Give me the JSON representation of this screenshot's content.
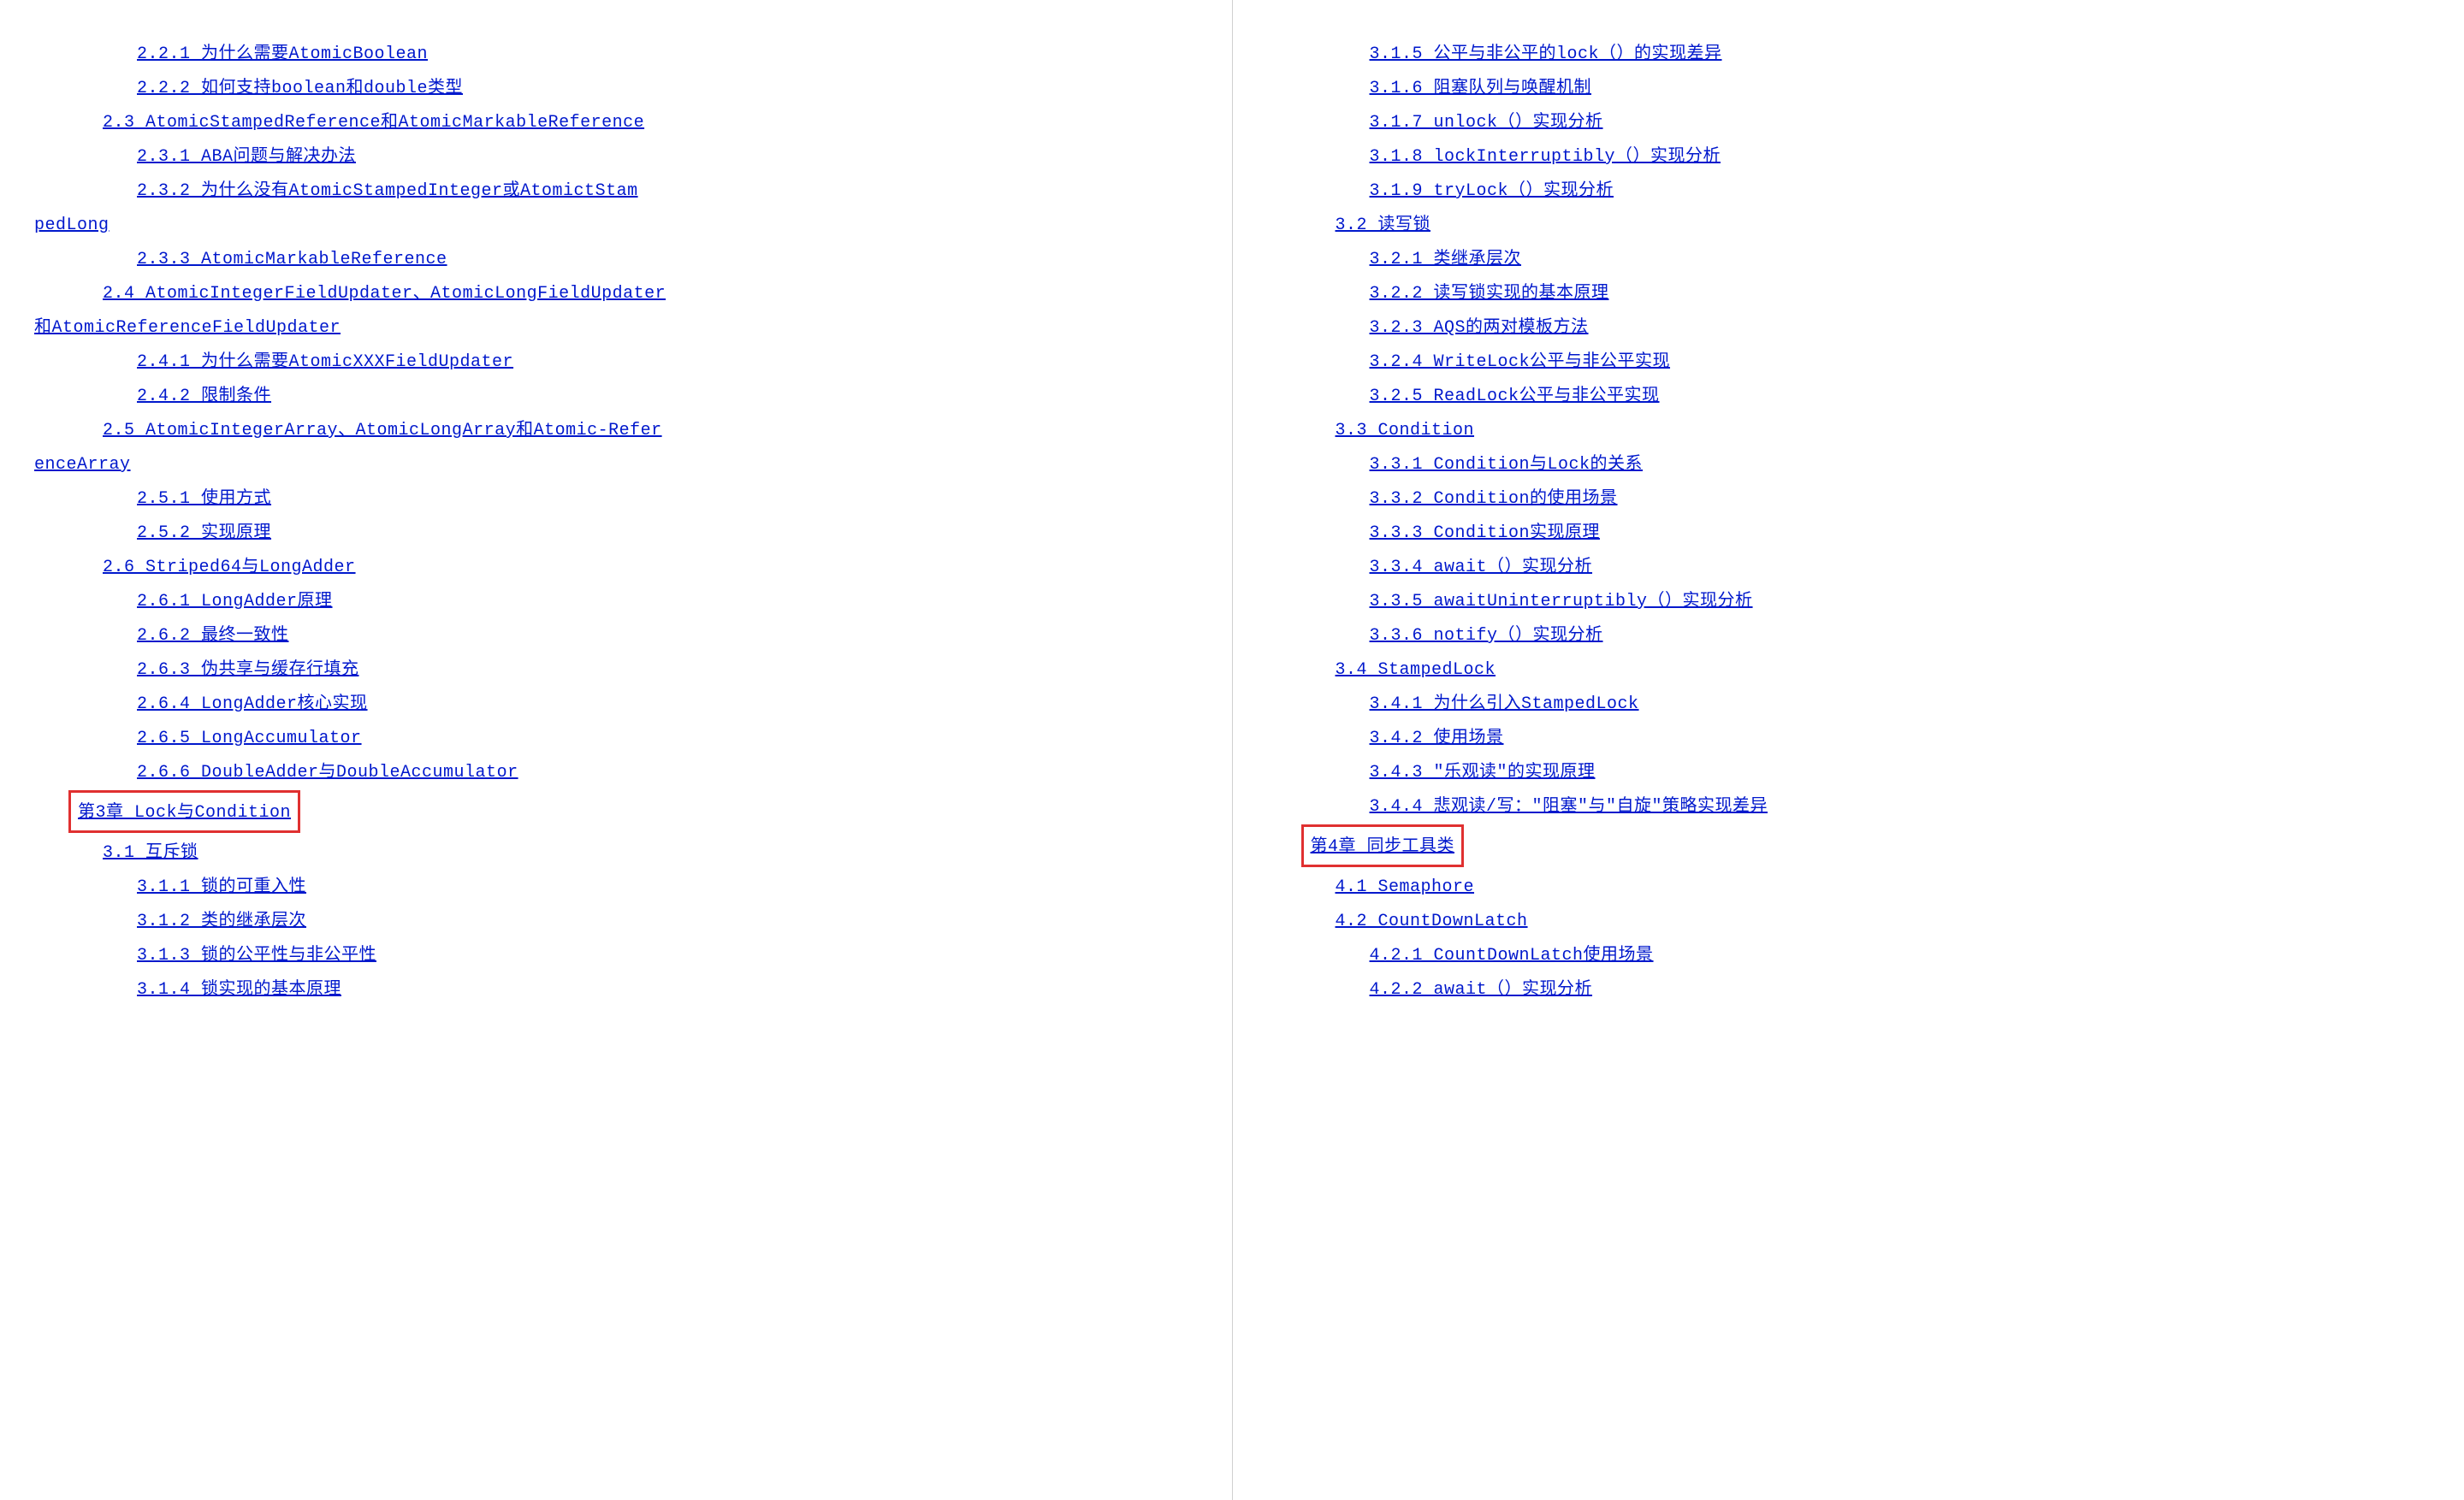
{
  "left": {
    "items": [
      {
        "text": "2.2.1 为什么需要AtomicBoolean",
        "indent": 3
      },
      {
        "text": "2.2.2 如何支持boolean和double类型",
        "indent": 3
      },
      {
        "text": "2.3 AtomicStampedReference和AtomicMarkableReference",
        "indent": 2
      },
      {
        "text": "2.3.1 ABA问题与解决办法",
        "indent": 3
      },
      {
        "text": "2.3.2 为什么没有AtomicStampedInteger或AtomictStam",
        "indent": 3
      },
      {
        "text": "pedLong",
        "indent": 0,
        "continuation": true
      },
      {
        "text": "2.3.3 AtomicMarkableReference",
        "indent": 3
      },
      {
        "text": "2.4 AtomicIntegerFieldUpdater、AtomicLongFieldUpdater",
        "indent": 2
      },
      {
        "text": "和AtomicReferenceFieldUpdater",
        "indent": 0,
        "continuation": true
      },
      {
        "text": "2.4.1 为什么需要AtomicXXXFieldUpdater",
        "indent": 3
      },
      {
        "text": "2.4.2 限制条件",
        "indent": 3
      },
      {
        "text": "2.5 AtomicIntegerArray、AtomicLongArray和Atomic-Refer",
        "indent": 2
      },
      {
        "text": "enceArray",
        "indent": 0,
        "continuation": true
      },
      {
        "text": "2.5.1 使用方式",
        "indent": 3
      },
      {
        "text": "2.5.2 实现原理",
        "indent": 3
      },
      {
        "text": "2.6 Striped64与LongAdder",
        "indent": 2
      },
      {
        "text": "2.6.1 LongAdder原理",
        "indent": 3
      },
      {
        "text": "2.6.2 最终一致性",
        "indent": 3
      },
      {
        "text": "2.6.3 伪共享与缓存行填充",
        "indent": 3
      },
      {
        "text": "2.6.4 LongAdder核心实现",
        "indent": 3
      },
      {
        "text": "2.6.5 LongAccumulator",
        "indent": 3
      },
      {
        "text": "2.6.6 DoubleAdder与DoubleAccumulator",
        "indent": 3
      },
      {
        "text": "第3章 Lock与Condition",
        "indent": 1,
        "highlight": true
      },
      {
        "text": "3.1 互斥锁",
        "indent": 2
      },
      {
        "text": "3.1.1 锁的可重入性",
        "indent": 3
      },
      {
        "text": "3.1.2 类的继承层次",
        "indent": 3
      },
      {
        "text": "3.1.3 锁的公平性与非公平性",
        "indent": 3
      },
      {
        "text": "3.1.4 锁实现的基本原理",
        "indent": 3
      }
    ]
  },
  "right": {
    "items": [
      {
        "text": "3.1.5 公平与非公平的lock（）的实现差异",
        "indent": 3
      },
      {
        "text": "3.1.6 阻塞队列与唤醒机制",
        "indent": 3
      },
      {
        "text": "3.1.7 unlock（）实现分析",
        "indent": 3
      },
      {
        "text": "3.1.8 lockInterruptibly（）实现分析",
        "indent": 3
      },
      {
        "text": "3.1.9 tryLock（）实现分析",
        "indent": 3
      },
      {
        "text": "3.2 读写锁",
        "indent": 2
      },
      {
        "text": "3.2.1 类继承层次",
        "indent": 3
      },
      {
        "text": "3.2.2 读写锁实现的基本原理",
        "indent": 3
      },
      {
        "text": "3.2.3 AQS的两对模板方法",
        "indent": 3
      },
      {
        "text": "3.2.4 WriteLock公平与非公平实现",
        "indent": 3
      },
      {
        "text": "3.2.5 ReadLock公平与非公平实现",
        "indent": 3
      },
      {
        "text": "3.3 Condition",
        "indent": 2
      },
      {
        "text": "3.3.1 Condition与Lock的关系",
        "indent": 3
      },
      {
        "text": "3.3.2 Condition的使用场景",
        "indent": 3
      },
      {
        "text": "3.3.3 Condition实现原理",
        "indent": 3
      },
      {
        "text": "3.3.4 await（）实现分析",
        "indent": 3
      },
      {
        "text": "3.3.5 awaitUninterruptibly（）实现分析",
        "indent": 3
      },
      {
        "text": "3.3.6 notify（）实现分析",
        "indent": 3
      },
      {
        "text": "3.4 StampedLock",
        "indent": 2
      },
      {
        "text": "3.4.1 为什么引入StampedLock",
        "indent": 3
      },
      {
        "text": "3.4.2 使用场景",
        "indent": 3
      },
      {
        "text": "3.4.3 \"乐观读\"的实现原理",
        "indent": 3
      },
      {
        "text": "3.4.4 悲观读/写：\"阻塞\"与\"自旋\"策略实现差异",
        "indent": 3
      },
      {
        "text": "第4章 同步工具类",
        "indent": 1,
        "highlight": true
      },
      {
        "text": "4.1 Semaphore",
        "indent": 2
      },
      {
        "text": "4.2 CountDownLatch",
        "indent": 2
      },
      {
        "text": "4.2.1 CountDownLatch使用场景",
        "indent": 3
      },
      {
        "text": "4.2.2 await（）实现分析",
        "indent": 3
      }
    ]
  }
}
